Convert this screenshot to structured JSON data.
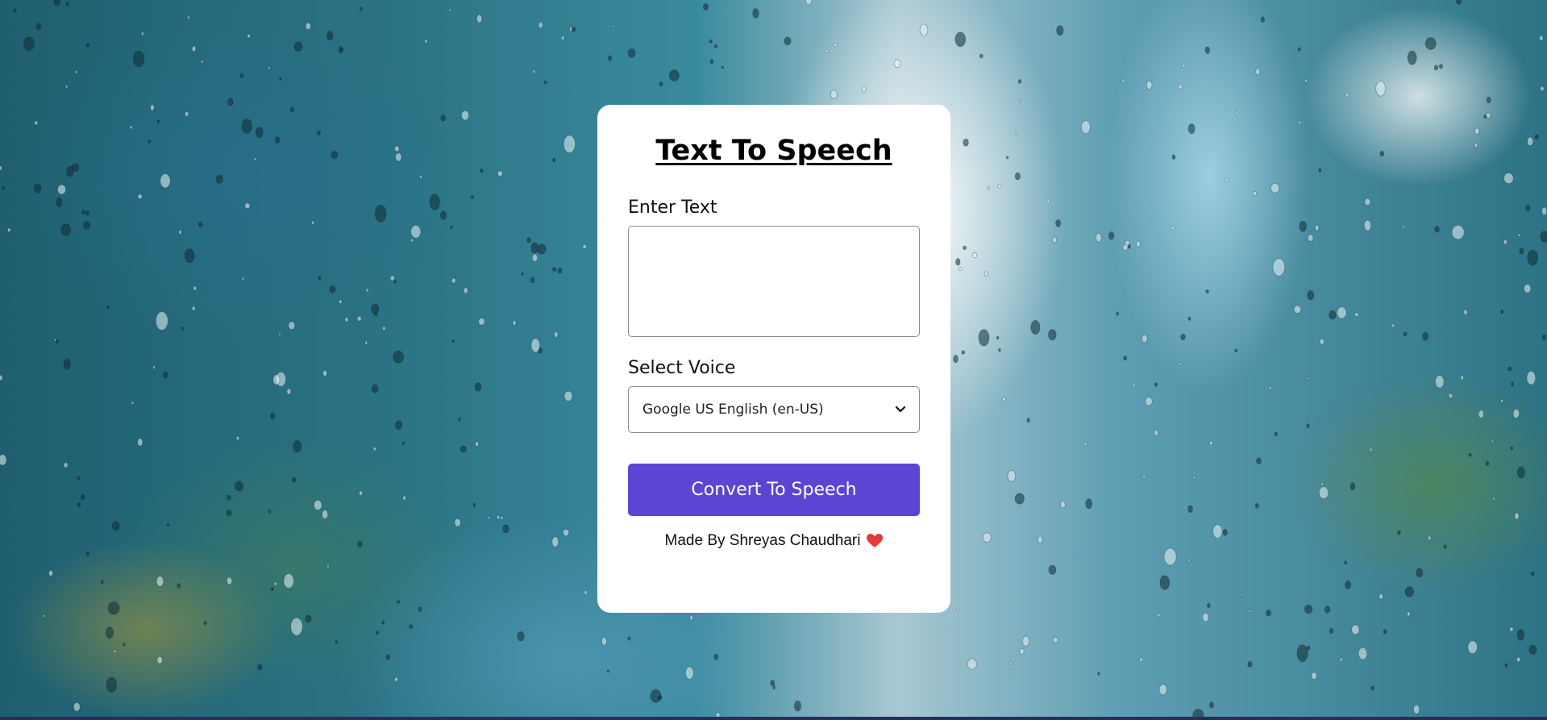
{
  "app": {
    "title": "Text To Speech"
  },
  "form": {
    "text_label": "Enter Text",
    "text_value": "",
    "voice_label": "Select Voice",
    "voice_selected": "Google US English (en-US)",
    "convert_label": "Convert To Speech"
  },
  "footer": {
    "credit": "Made By Shreyas Chaudhari",
    "heart_icon": "heart-icon"
  },
  "colors": {
    "button": "#5b46d4",
    "card": "#ffffff",
    "heart": "#e23b3b"
  }
}
